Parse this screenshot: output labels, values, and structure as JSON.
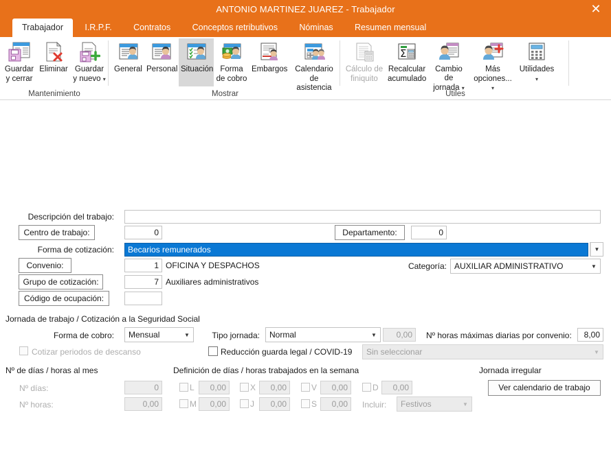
{
  "window": {
    "title": "ANTONIO MARTINEZ JUAREZ - Trabajador",
    "close_label": "✕",
    "accent_color": "#e8711a",
    "selection_color": "#0a78d4"
  },
  "tabs": [
    {
      "label": "Trabajador",
      "active": true
    },
    {
      "label": "I.R.P.F.",
      "active": false
    },
    {
      "label": "Contratos",
      "active": false
    },
    {
      "label": "Conceptos retributivos",
      "active": false
    },
    {
      "label": "Nóminas",
      "active": false
    },
    {
      "label": "Resumen mensual",
      "active": false
    }
  ],
  "ribbon": {
    "groups": [
      {
        "title": "Mantenimiento"
      },
      {
        "title": "Mostrar"
      },
      {
        "title": "Útiles"
      }
    ],
    "buttons": {
      "guardar_cerrar": {
        "l1": "Guardar",
        "l2": "y cerrar",
        "icon": "save-close-icon"
      },
      "eliminar": {
        "l1": "Eliminar",
        "l2": "",
        "icon": "delete-icon"
      },
      "guardar_nuevo": {
        "l1": "Guardar",
        "l2": "y nuevo",
        "icon": "save-new-icon",
        "caret": "▾"
      },
      "general": {
        "l1": "General",
        "l2": "",
        "icon": "general-person-icon"
      },
      "personal": {
        "l1": "Personal",
        "l2": "",
        "icon": "personal-person-icon"
      },
      "situacion": {
        "l1": "Situación",
        "l2": "",
        "icon": "situacion-icon",
        "selected": true
      },
      "forma_cobro": {
        "l1": "Forma",
        "l2": "de cobro",
        "icon": "payment-icon"
      },
      "embargos": {
        "l1": "Embargos",
        "l2": "",
        "icon": "embargos-icon"
      },
      "calendario": {
        "l1": "Calendario",
        "l2": "de asistencia",
        "icon": "calendar-icon"
      },
      "calculo_finiquito": {
        "l1": "Cálculo de",
        "l2": "finiquito",
        "icon": "settlement-icon",
        "disabled": true
      },
      "recalcular": {
        "l1": "Recalcular",
        "l2": "acumulado",
        "icon": "sigma-icon"
      },
      "cambio_jornada": {
        "l1": "Cambio de",
        "l2": "jornada",
        "icon": "workday-change-icon",
        "caret": "▾"
      },
      "mas_opciones": {
        "l1": "Más",
        "l2": "opciones...",
        "icon": "more-options-icon",
        "caret": "▾"
      },
      "utilidades": {
        "l1": "Utilidades",
        "l2": "",
        "icon": "calculator-icon",
        "caret": "▾"
      }
    }
  },
  "form": {
    "descripcion_label": "Descripción del trabajo:",
    "descripcion_value": "",
    "centro_trabajo_button": "Centro de trabajo:",
    "centro_trabajo_value": "0",
    "departamento_button": "Departamento:",
    "departamento_value": "0",
    "forma_cotizacion_label": "Forma de cotización:",
    "forma_cotizacion_value": "Becarios remunerados",
    "convenio_button": "Convenio:",
    "convenio_code": "1",
    "convenio_name": "OFICINA Y DESPACHOS",
    "categoria_label": "Categoría:",
    "categoria_value": "AUXILIAR ADMINISTRATIVO",
    "grupo_cotizacion_button": "Grupo de cotización:",
    "grupo_cotizacion_code": "7",
    "grupo_cotizacion_name": "Auxiliares administrativos",
    "codigo_ocupacion_button": "Código de ocupación:",
    "codigo_ocupacion_value": ""
  },
  "jornada": {
    "section_title": "Jornada de trabajo / Cotización a la Seguridad Social",
    "forma_cobro_label": "Forma de cobro:",
    "forma_cobro_value": "Mensual",
    "cotizar_descanso_label": "Cotizar periodos de descanso",
    "cotizar_descanso_checked": false,
    "tipo_jornada_label": "Tipo jornada:",
    "tipo_jornada_value": "Normal",
    "tipo_jornada_num": "0,00",
    "reduccion_label": "Reducción guarda legal / COVID-19",
    "reduccion_checked": false,
    "reduccion_combo_value": "Sin seleccionar",
    "horas_max_label": "Nº horas máximas diarias por convenio:",
    "horas_max_value": "8,00"
  },
  "dias_horas": {
    "section_title": "Nº de días / horas al mes",
    "dias_label": "Nº días:",
    "dias_value": "0",
    "horas_label": "Nº horas:",
    "horas_value": "0,00"
  },
  "semana": {
    "section_title": "Definición de días / horas trabajados en la semana",
    "days": [
      {
        "code": "L",
        "value": "0,00",
        "checked": false
      },
      {
        "code": "M",
        "value": "0,00",
        "checked": false
      },
      {
        "code": "X",
        "value": "0,00",
        "checked": false
      },
      {
        "code": "J",
        "value": "0,00",
        "checked": false
      },
      {
        "code": "V",
        "value": "0,00",
        "checked": false
      },
      {
        "code": "S",
        "value": "0,00",
        "checked": false
      },
      {
        "code": "D",
        "value": "0,00",
        "checked": false
      }
    ],
    "incluir_label": "Incluir:",
    "incluir_value": "Festivos"
  },
  "irregular": {
    "section_title": "Jornada irregular",
    "ver_calendario_button": "Ver calendario de trabajo"
  }
}
